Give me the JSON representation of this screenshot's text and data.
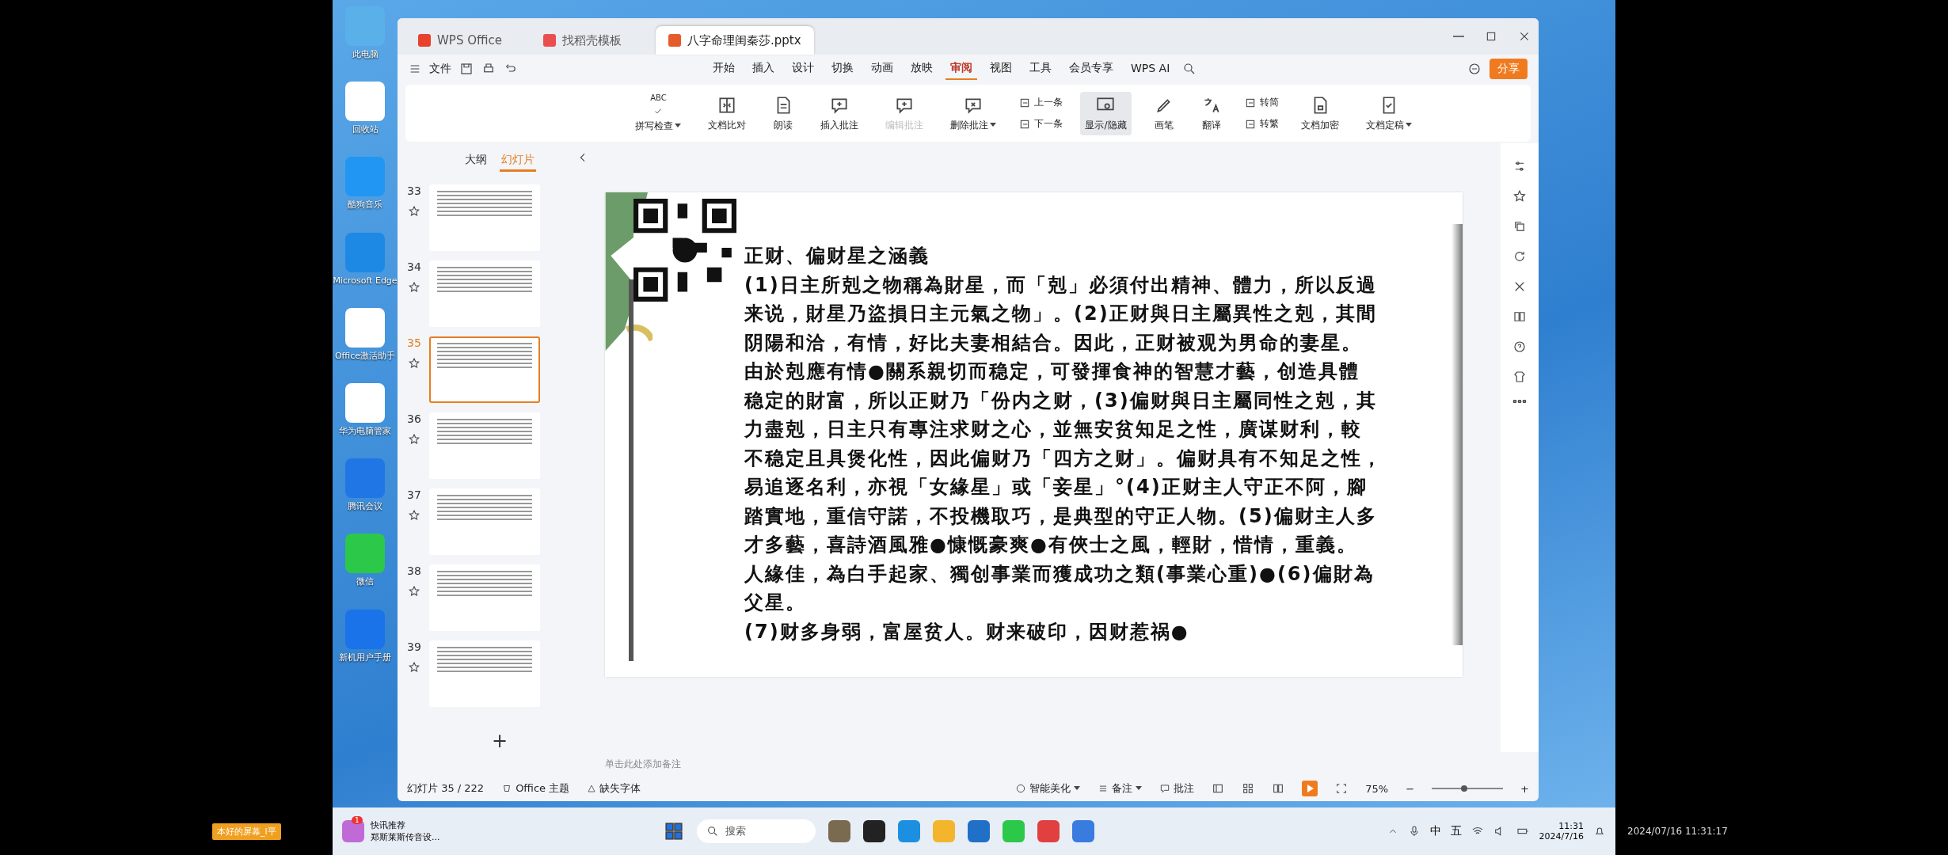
{
  "desktop_icons": [
    {
      "label": "此电脑"
    },
    {
      "label": "回收站"
    },
    {
      "label": "酷狗音乐"
    },
    {
      "label": "Microsoft Edge"
    },
    {
      "label": "Office激活助手"
    },
    {
      "label": "华为电脑管家"
    },
    {
      "label": "腾讯会议"
    },
    {
      "label": "微信"
    },
    {
      "label": "新机用户手册"
    }
  ],
  "window": {
    "tabs": [
      {
        "label": "WPS Office",
        "selected": false
      },
      {
        "label": "找稻壳模板",
        "selected": false
      },
      {
        "label": "八字命理闺秦莎.pptx",
        "selected": true
      }
    ]
  },
  "menu": {
    "file": "文件",
    "tabs": [
      {
        "label": "开始",
        "selected": false
      },
      {
        "label": "插入",
        "selected": false
      },
      {
        "label": "设计",
        "selected": false
      },
      {
        "label": "切换",
        "selected": false
      },
      {
        "label": "动画",
        "selected": false
      },
      {
        "label": "放映",
        "selected": false
      },
      {
        "label": "审阅",
        "selected": true
      },
      {
        "label": "视图",
        "selected": false
      },
      {
        "label": "工具",
        "selected": false
      },
      {
        "label": "会员专享",
        "selected": false
      }
    ],
    "ai": "WPS AI",
    "share": "分享"
  },
  "toolbar": [
    {
      "kind": "large",
      "label": "拼写检查",
      "badge": "ABC",
      "dropdown": true,
      "disabled": false,
      "selected": false
    },
    {
      "kind": "large",
      "label": "文档比对",
      "dropdown": false,
      "disabled": false,
      "selected": false
    },
    {
      "kind": "large",
      "label": "朗读",
      "dropdown": false,
      "disabled": false,
      "selected": false
    },
    {
      "kind": "large",
      "label": "插入批注",
      "dropdown": false,
      "disabled": false,
      "selected": false
    },
    {
      "kind": "large",
      "label": "编辑批注",
      "dropdown": false,
      "disabled": true,
      "selected": false
    },
    {
      "kind": "large",
      "label": "删除批注",
      "dropdown": true,
      "disabled": false,
      "selected": false
    },
    {
      "kind": "pair",
      "items": [
        "上一条",
        "下一条"
      ]
    },
    {
      "kind": "large",
      "label": "显示/隐藏",
      "dropdown": false,
      "disabled": false,
      "selected": true
    },
    {
      "kind": "large",
      "label": "画笔",
      "dropdown": false,
      "disabled": false,
      "selected": false
    },
    {
      "kind": "large",
      "label": "翻译",
      "dropdown": false,
      "disabled": false,
      "selected": false
    },
    {
      "kind": "pair",
      "items": [
        "转简",
        "转繁"
      ]
    },
    {
      "kind": "large",
      "label": "文档加密",
      "dropdown": false,
      "disabled": false,
      "selected": false
    },
    {
      "kind": "large",
      "label": "文档定稿",
      "dropdown": true,
      "disabled": false,
      "selected": false
    }
  ],
  "panel": {
    "tabs": [
      {
        "label": "大纲",
        "selected": false
      },
      {
        "label": "幻灯片",
        "selected": true
      }
    ],
    "slides": [
      {
        "number": "33",
        "selected": false
      },
      {
        "number": "34",
        "selected": false
      },
      {
        "number": "35",
        "selected": true
      },
      {
        "number": "36",
        "selected": false
      },
      {
        "number": "37",
        "selected": false
      },
      {
        "number": "38",
        "selected": false
      },
      {
        "number": "39",
        "selected": false
      }
    ],
    "add": "+"
  },
  "slide": {
    "title": "正财、偏财星之涵義",
    "lines": [
      "(1)日主所剋之物稱為財星，而「剋」必須付出精神、體力，所以反過",
      "来说，財星乃盜損日主元氣之物」。(2)正财與日主屬異性之剋，其間",
      "阴陽和洽，有情，好比夫妻相結合。因此，正财被观为男命的妻星。",
      "由於剋應有情●關系親切而稳定，可發揮食神的智慧才藝，创造具體",
      "稳定的財富，所以正财乃「份内之财，(3)偏财與日主屬同性之剋，其",
      "力盡剋，日主只有專注求财之心，並無安贫知足之性，廣谋财利，較",
      "不稳定且具煲化性，因此偏财乃「四方之财」。偏财具有不知足之性，",
      "易追逐名利，亦視「女緣星」或「妾星」°(4)正财主人守正不阿，腳",
      "踏實地，重信守諾，不投機取巧，是典型的守正人物。(5)偏财主人多",
      "才多藝，喜詩酒風雅●慷慨豪爽●有俠士之風，輕財，惜情，重義。",
      "人緣佳，為白手起家、獨创事業而獲成功之類(事業心重)●(6)偏財為",
      "父星。",
      "(7)财多身弱，富屋贫人。财来破印，因财惹祸●"
    ]
  },
  "notes": {
    "placeholder": "单击此处添加备注"
  },
  "status_bar": {
    "slide_count": "幻灯片 35 / 222",
    "theme": "Office 主题",
    "missing_fonts": "缺失字体",
    "beautify": "智能美化",
    "notes": "备注",
    "comments": "批注",
    "zoom": "75%",
    "zoom_minus": "−",
    "zoom_plus": "+",
    "zoom_slider": {
      "level": 0.45
    }
  },
  "taskbar": {
    "news": {
      "title": "快讯推荐",
      "subtitle": "郑斯莱斯传音设...",
      "badge": "1"
    },
    "search": {
      "placeholder": "搜索"
    },
    "tray": {
      "ime": "中",
      "ime_mode": "五",
      "time": "11:31",
      "date": "2024/7/16"
    }
  },
  "recorder": {
    "label": "本好的屏幕_l平"
  },
  "timestamp": "2024/07/16 11:31:17"
}
